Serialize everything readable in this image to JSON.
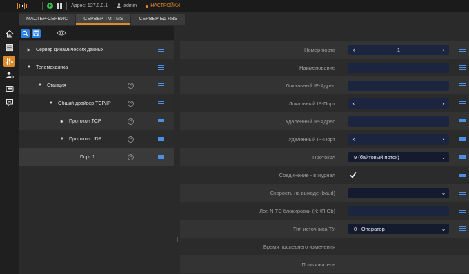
{
  "topbar": {
    "address": "Адрес: 127.0.0.1",
    "user": "admin",
    "settings": "НАСТРОЙКИ"
  },
  "tabs": [
    {
      "label": "МАСТЕР-СЕРВИС"
    },
    {
      "label": "СЕРВЕР ТМ TMS",
      "active": true
    },
    {
      "label": "СЕРВЕР БД RBS"
    }
  ],
  "tree": [
    {
      "label": "Сервер динамических данных",
      "caret": "▶",
      "level": 0
    },
    {
      "label": "Телемеханика",
      "caret": "▼",
      "level": 0
    },
    {
      "label": "Станция",
      "caret": "▼",
      "level": 1
    },
    {
      "label": "Общий драйвер TCP/IP",
      "caret": "▼",
      "level": 2
    },
    {
      "label": "Протокол TCP",
      "caret": "▶",
      "level": 3
    },
    {
      "label": "Протокол UDP",
      "caret": "▼",
      "level": 3
    },
    {
      "label": "Порт 1",
      "caret": "",
      "level": 4
    }
  ],
  "props": [
    {
      "label": "Номер порта",
      "value": "1",
      "kind": "stepper"
    },
    {
      "label": "Наименование",
      "value": "",
      "kind": "text"
    },
    {
      "label": "Локальный IP-Адрес",
      "value": "",
      "kind": "text"
    },
    {
      "label": "Локальный IP-Порт",
      "value": "",
      "kind": "stepper"
    },
    {
      "label": "Удаленный IP-Адрес",
      "value": "",
      "kind": "text"
    },
    {
      "label": "Удаленный IP-Порт",
      "value": "",
      "kind": "stepper"
    },
    {
      "label": "Протокол",
      "value": "9 (байтовый поток)",
      "kind": "select"
    },
    {
      "label": "Соединение - в журнал",
      "value": "",
      "kind": "check"
    },
    {
      "label": "Скорость на выходе (baud)",
      "value": "",
      "kind": "select"
    },
    {
      "label": "Лог. N ТС блокировки (К:КП:Ob)",
      "value": "",
      "kind": "text"
    },
    {
      "label": "Тип источника ТУ",
      "value": "0 - Оператор",
      "kind": "select"
    },
    {
      "label": "Время последнего изменения",
      "value": "",
      "kind": "none"
    },
    {
      "label": "Пользователь",
      "value": "",
      "kind": "none"
    }
  ],
  "colors": {
    "accent": "#e0892a",
    "blue": "#2f7fe0",
    "field": "#1c2540"
  }
}
